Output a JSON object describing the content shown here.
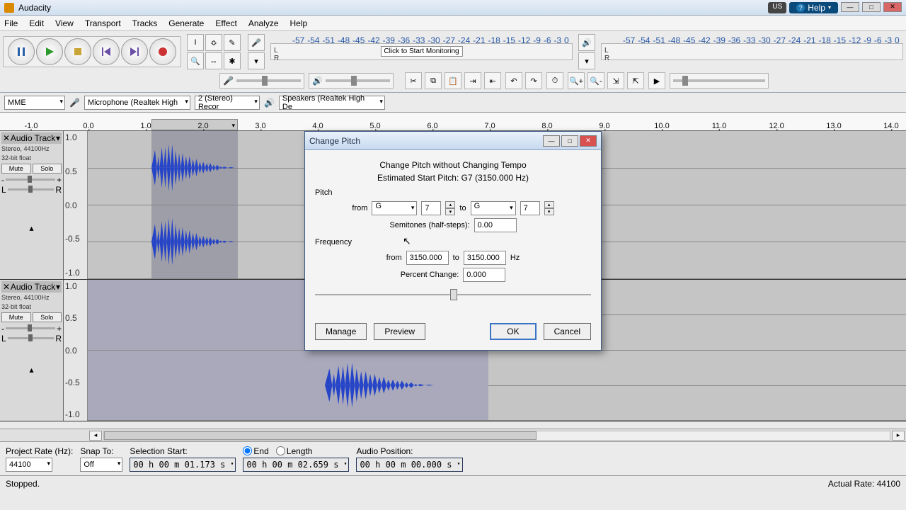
{
  "app_title": "Audacity",
  "menus": [
    "File",
    "Edit",
    "View",
    "Transport",
    "Tracks",
    "Generate",
    "Effect",
    "Analyze",
    "Help"
  ],
  "lang": "US",
  "help": "Help",
  "meter_ticks": [
    "-57",
    "-54",
    "-51",
    "-48",
    "-45",
    "-42",
    "-39",
    "-36",
    "-33",
    "-30",
    "-27",
    "-24",
    "-21",
    "-18",
    "-15",
    "-12",
    "-9",
    "-6",
    "-3",
    "0"
  ],
  "click_to_start": "Click to Start Monitoring",
  "device": {
    "host": "MME",
    "input": "Microphone (Realtek High",
    "channels": "2 (Stereo) Recor",
    "output": "Speakers (Realtek High De"
  },
  "ruler": [
    "-1.0",
    "0.0",
    "1.0",
    "2.0",
    "3.0",
    "4.0",
    "5.0",
    "6.0",
    "7.0",
    "8.0",
    "9.0",
    "10.0",
    "11.0",
    "12.0",
    "13.0",
    "14.0"
  ],
  "track": {
    "name": "Audio Track",
    "meta1": "Stereo, 44100Hz",
    "meta2": "32-bit float",
    "mute": "Mute",
    "solo": "Solo",
    "scale": [
      "1.0",
      "0.5",
      "0.0",
      "-0.5",
      "-1.0"
    ]
  },
  "bottom": {
    "proj_label": "Project Rate (Hz):",
    "proj_rate": "44100",
    "snap_label": "Snap To:",
    "snap": "Off",
    "sel_start_label": "Selection Start:",
    "end": "End",
    "length": "Length",
    "start_tc": "00 h 00 m 01.173 s",
    "end_tc": "00 h 00 m 02.659 s",
    "audio_pos_label": "Audio Position:",
    "audio_pos": "00 h 00 m 00.000 s"
  },
  "status": {
    "left": "Stopped.",
    "right": "Actual Rate: 44100"
  },
  "dialog": {
    "title": "Change Pitch",
    "subtitle": "Change Pitch without Changing Tempo",
    "est": "Estimated Start Pitch: G7 (3150.000 Hz)",
    "pitch_label": "Pitch",
    "from": "from",
    "to": "to",
    "note_from": "G",
    "oct_from": "7",
    "note_to": "G",
    "oct_to": "7",
    "semi_label": "Semitones (half-steps):",
    "semi": "0.00",
    "freq_label": "Frequency",
    "freq_from": "3150.000",
    "freq_to": "3150.000",
    "hz": "Hz",
    "pct_label": "Percent Change:",
    "pct": "0.000",
    "manage": "Manage",
    "preview": "Preview",
    "ok": "OK",
    "cancel": "Cancel"
  }
}
